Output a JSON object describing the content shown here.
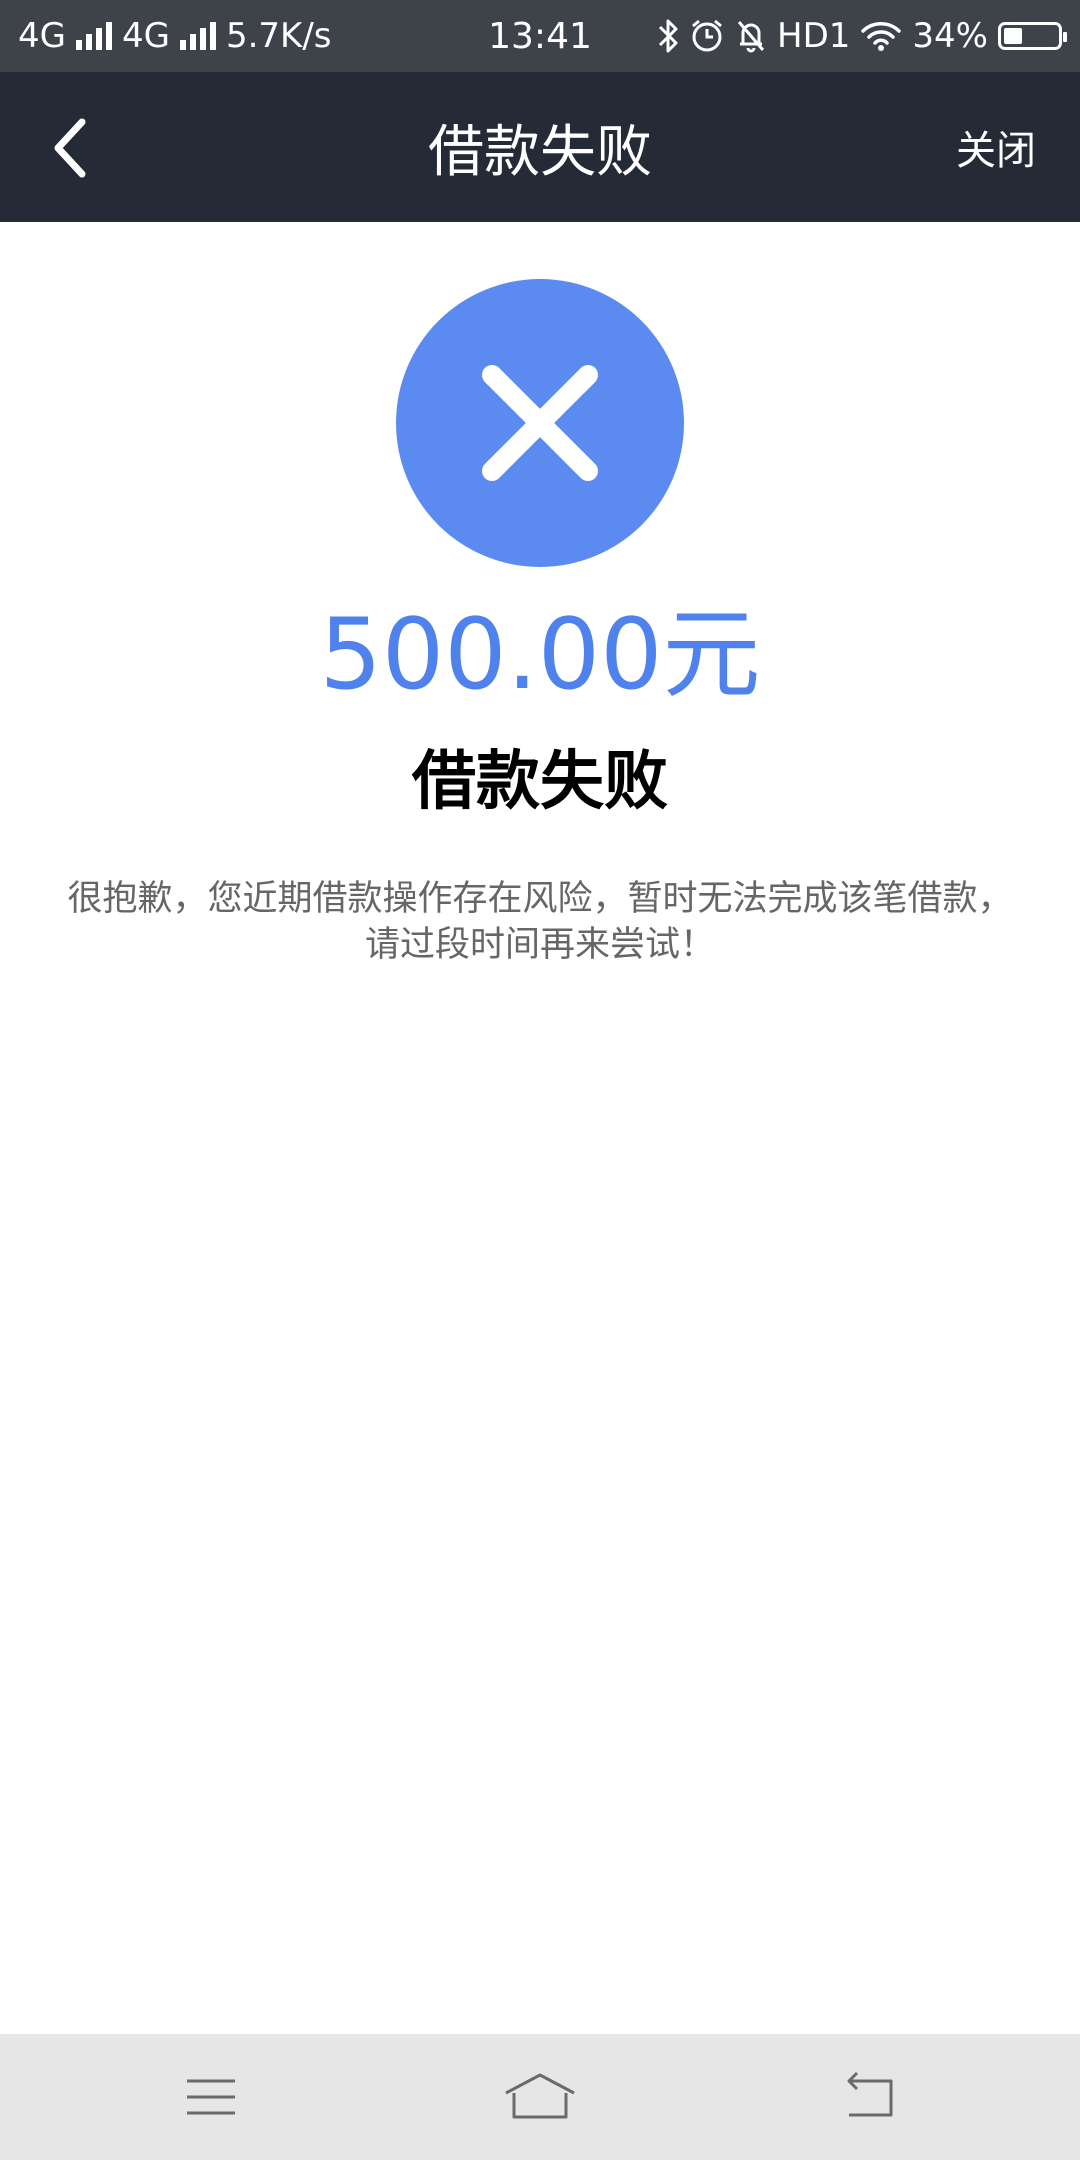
{
  "status_bar": {
    "network1": "4G",
    "network2": "4G",
    "speed": "5.7K/s",
    "time": "13:41",
    "hd": "HD1",
    "battery_text": "34%",
    "battery_level": 0.34
  },
  "nav": {
    "title": "借款失败",
    "close_label": "关闭"
  },
  "result": {
    "amount": "500.00元",
    "status": "借款失败",
    "message": "很抱歉，您近期借款操作存在风险，暂时无法完成该笔借款，请过段时间再来尝试！"
  },
  "colors": {
    "accent": "#5b8bf1",
    "amount": "#4f82ec",
    "nav_bg": "#252a37"
  },
  "icons": {
    "back": "chevron-left-icon",
    "fail": "close-x-icon",
    "menu": "menu-icon",
    "home": "home-icon",
    "return": "return-icon"
  }
}
